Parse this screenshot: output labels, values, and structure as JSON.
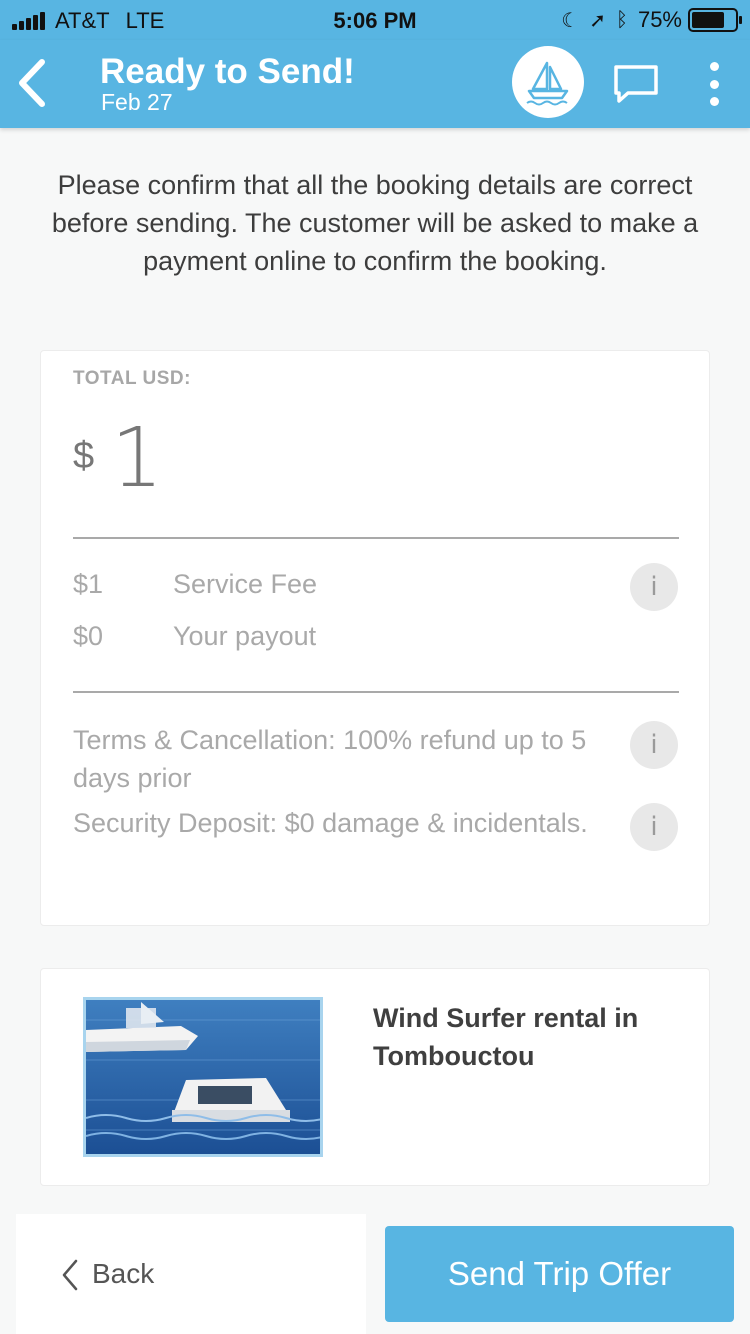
{
  "status_bar": {
    "carrier": "AT&T",
    "network": "LTE",
    "time": "5:06 PM",
    "battery": "75%",
    "battery_level": 0.75
  },
  "header": {
    "title": "Ready to Send!",
    "subtitle": "Feb 27"
  },
  "intro_text": "Please confirm that all the booking details are correct before sending. The customer will be asked to make a payment online to confirm the booking.",
  "total": {
    "label": "TOTAL USD:",
    "currency_symbol": "$",
    "amount": "1"
  },
  "fees": [
    {
      "amount": "$1",
      "label": "Service Fee"
    },
    {
      "amount": "$0",
      "label": "Your payout"
    }
  ],
  "terms": {
    "cancellation": "Terms & Cancellation: 100% refund up to 5 days prior",
    "deposit": "Security Deposit: $0 damage & incidentals."
  },
  "info_glyph": "i",
  "trip": {
    "title": "Wind Surfer rental in Tombouctou"
  },
  "footer": {
    "back_label": "Back",
    "send_label": "Send Trip Offer"
  },
  "colors": {
    "accent": "#58b5e2",
    "muted_text": "#a9a9a9"
  }
}
